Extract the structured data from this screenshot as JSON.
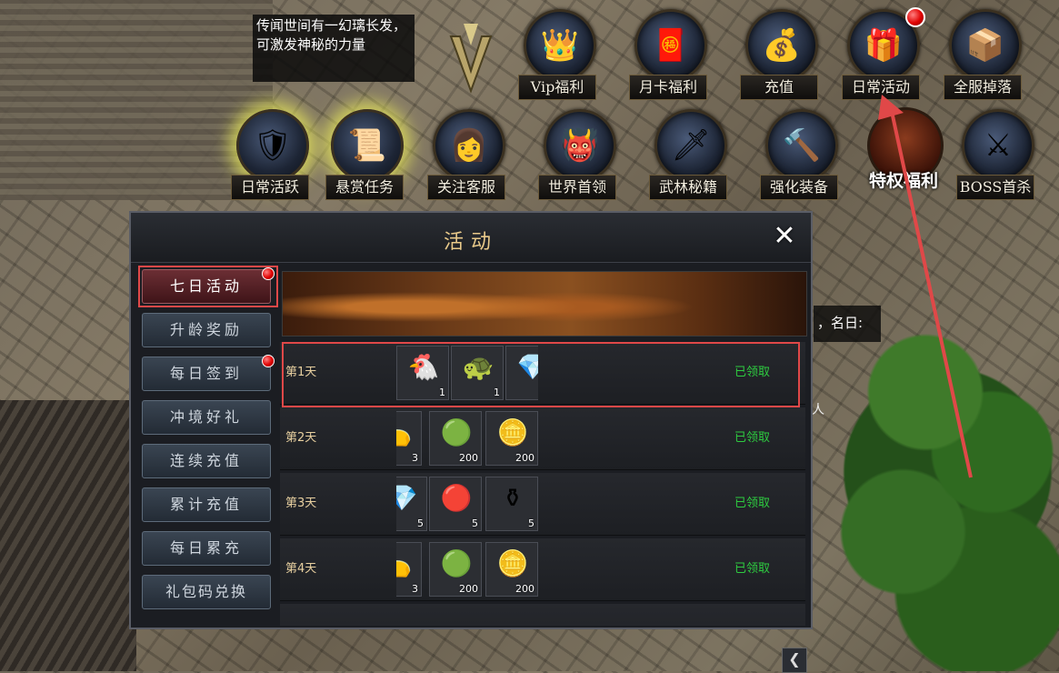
{
  "tooltip": {
    "text": "传闻世间有一幻璃长发，可激发神秘的力量"
  },
  "side_text": {
    "fragment": "，名日:",
    "fragment2": "人"
  },
  "top_icons": [
    {
      "label": "Vip福利",
      "icon": "vip-icon",
      "glyph": "👑"
    },
    {
      "label": "月卡福利",
      "icon": "month-card-icon",
      "glyph": "🧧"
    },
    {
      "label": "充值",
      "icon": "gold-ingot-icon",
      "glyph": "💰"
    },
    {
      "label": "日常活动",
      "icon": "treasure-chest-icon",
      "glyph": "🎁"
    },
    {
      "label": "全服掉落",
      "icon": "chest-icon",
      "glyph": "📦"
    }
  ],
  "second_icons": [
    {
      "label": "日常活跃",
      "icon": "daily-active-icon",
      "glyph": "🛡"
    },
    {
      "label": "悬赏任务",
      "icon": "bounty-icon",
      "glyph": "📜"
    },
    {
      "label": "关注客服",
      "icon": "customer-service-icon",
      "glyph": "👩"
    },
    {
      "label": "世界首领",
      "icon": "world-boss-icon",
      "glyph": "👹"
    },
    {
      "label": "武林秘籍",
      "icon": "martial-book-icon",
      "glyph": "🗡"
    },
    {
      "label": "强化装备",
      "icon": "hammer-icon",
      "glyph": "🔨"
    }
  ],
  "privilege": {
    "label": "特权福利",
    "icon": "privilege-icon"
  },
  "boss_kill": {
    "label": "BOSS首杀",
    "icon": "boss-kill-icon",
    "glyph": "⚔"
  },
  "panel": {
    "title": "活动",
    "close_glyph": "✕",
    "tabs": [
      {
        "label": "七日活动",
        "active": true,
        "dot": true
      },
      {
        "label": "升龄奖励",
        "active": false,
        "dot": false
      },
      {
        "label": "每日签到",
        "active": false,
        "dot": true
      },
      {
        "label": "冲境好礼",
        "active": false,
        "dot": false
      },
      {
        "label": "连续充值",
        "active": false,
        "dot": false
      },
      {
        "label": "累计充值",
        "active": false,
        "dot": false
      },
      {
        "label": "每日累充",
        "active": false,
        "dot": false
      },
      {
        "label": "礼包码兑换",
        "active": false,
        "dot": false
      }
    ],
    "rows": [
      {
        "day": "第1天",
        "status": "已领取",
        "items": [
          {
            "glyph": "🐔",
            "count": "1"
          },
          {
            "glyph": "🐢",
            "count": "1"
          },
          {
            "glyph": "💎",
            "count": ""
          }
        ]
      },
      {
        "day": "第2天",
        "status": "已领取",
        "items": [
          {
            "glyph": "👝",
            "count": "3"
          },
          {
            "glyph": "🟢",
            "count": "200"
          },
          {
            "glyph": "🪙",
            "count": "200"
          }
        ]
      },
      {
        "day": "第3天",
        "status": "已领取",
        "items": [
          {
            "glyph": "💎",
            "count": "5"
          },
          {
            "glyph": "🔴",
            "count": "5"
          },
          {
            "glyph": "⚱",
            "count": "5"
          }
        ]
      },
      {
        "day": "第4天",
        "status": "已领取",
        "items": [
          {
            "glyph": "👝",
            "count": "3"
          },
          {
            "glyph": "🟢",
            "count": "200"
          },
          {
            "glyph": "🪙",
            "count": "200"
          }
        ]
      }
    ]
  },
  "nav": {
    "scroll_left_glyph": "❮"
  },
  "colors": {
    "accent_red": "#e04848",
    "claimed_green": "#2ecc40",
    "title_gold": "#e8c98a"
  }
}
